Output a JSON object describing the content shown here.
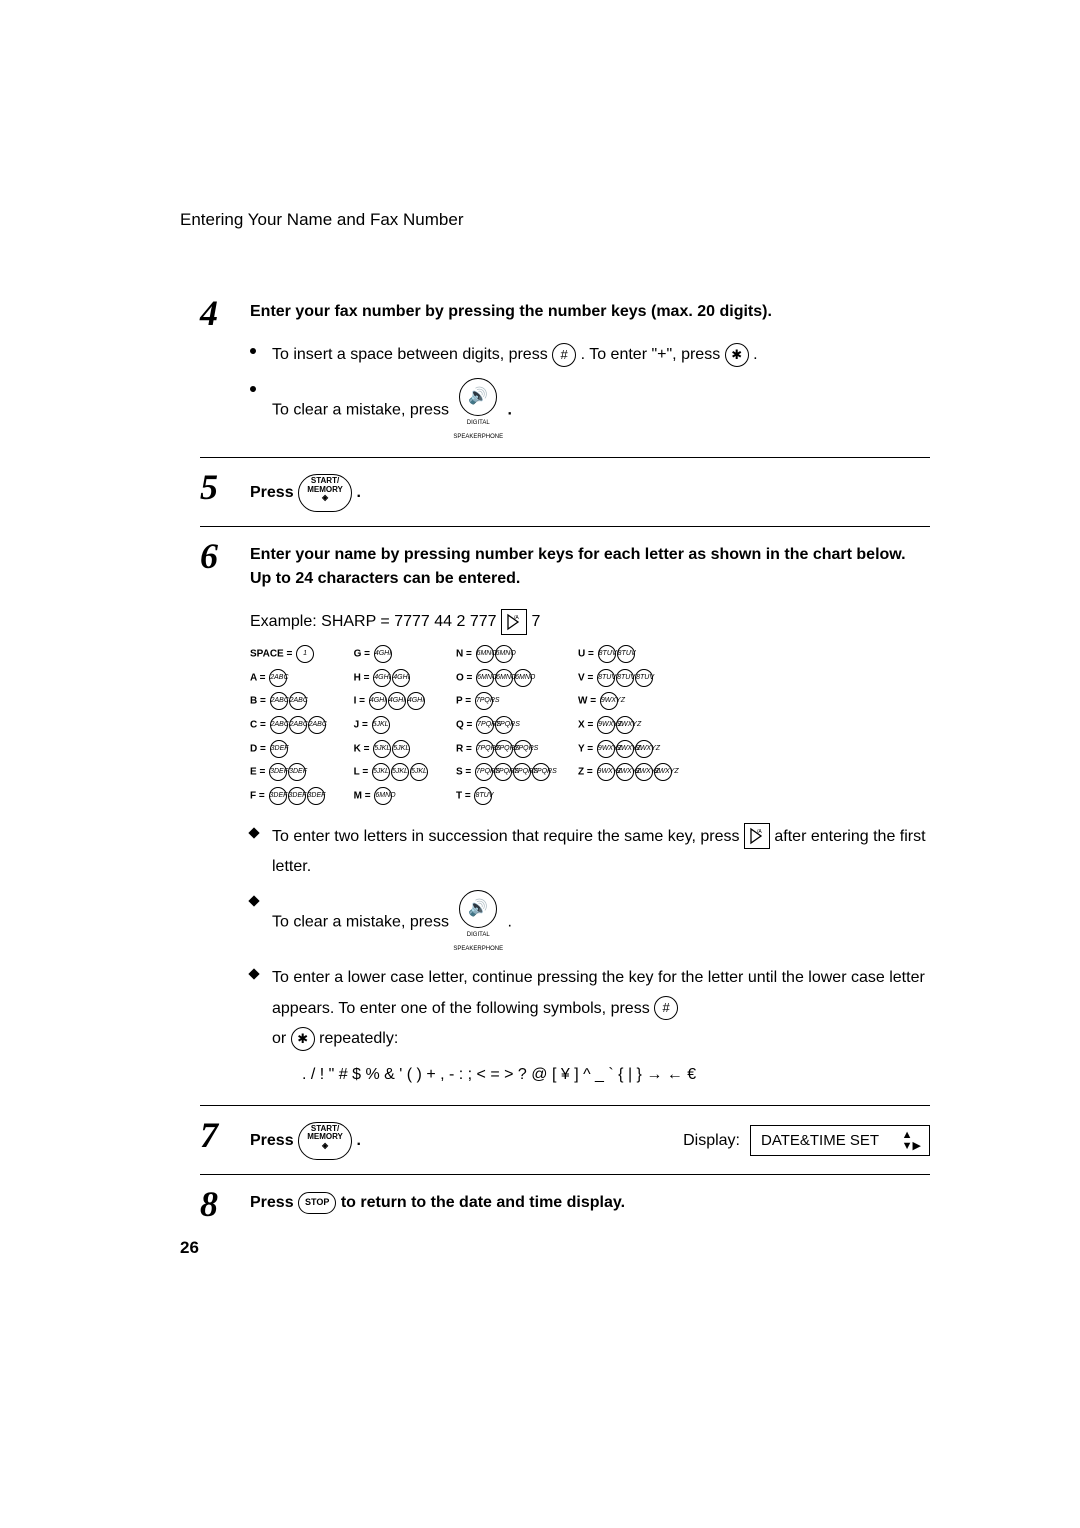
{
  "header": {
    "title": "Entering Your Name and Fax Number"
  },
  "steps": {
    "s4": {
      "num": "4",
      "title": "Enter your fax number by pressing the number keys (max. 20 digits).",
      "b1_pre": "To insert a space between digits, press ",
      "b1_mid": ". To enter \"+\", press ",
      "b1_post": ".",
      "b2": "To clear a mistake, press "
    },
    "s5": {
      "num": "5",
      "title_pre": "Press ",
      "title_post": " ."
    },
    "s6": {
      "num": "6",
      "title": "Enter your name by pressing number keys for each letter as shown in the chart below. Up to 24 characters can be entered.",
      "example_pre": "Example: SHARP = 7777  44  2  777 ",
      "example_post": " 7",
      "d1_pre": "To enter two letters in succession that require the same key, press ",
      "d1_post": " after entering the first letter.",
      "d2": "To clear a mistake, press ",
      "d3_a": "To enter a lower case letter, continue pressing the key for the letter until the lower case letter appears. To enter one of the following symbols, press ",
      "d3_b": "or ",
      "d3_c": " repeatedly:",
      "symbols": ". / ! \" # $ % & ' ( )  + , - : ; < = > ? @ [ ¥ ]  ^ _ ` { | } → ← €"
    },
    "s7": {
      "num": "7",
      "title_pre": "Press ",
      "title_post": " .",
      "display_label": "Display:",
      "display_text": "DATE&TIME SET"
    },
    "s8": {
      "num": "8",
      "title_pre": "Press ",
      "title_post": " to return to the date and time display."
    }
  },
  "keys": {
    "hash": "#",
    "star": "✱",
    "start_memory_l1": "START/",
    "start_memory_l2": "MEMORY",
    "stop": "STOP",
    "speaker_sub1": "DIGITAL",
    "speaker_sub2": "SPEAKERPHONE",
    "right_arrow": "▷/A"
  },
  "char_map": {
    "col1": [
      {
        "label": "SPACE =",
        "keys": [
          "1"
        ]
      },
      {
        "label": "A =",
        "keys": [
          "2ABC"
        ]
      },
      {
        "label": "B =",
        "keys": [
          "2ABC",
          "2ABC"
        ]
      },
      {
        "label": "C =",
        "keys": [
          "2ABC",
          "2ABC",
          "2ABC"
        ]
      },
      {
        "label": "D =",
        "keys": [
          "3DEF"
        ]
      },
      {
        "label": "E =",
        "keys": [
          "3DEF",
          "3DEF"
        ]
      },
      {
        "label": "F =",
        "keys": [
          "3DEF",
          "3DEF",
          "3DEF"
        ]
      }
    ],
    "col2": [
      {
        "label": "G =",
        "keys": [
          "4GHI"
        ]
      },
      {
        "label": "H =",
        "keys": [
          "4GHI",
          "4GHI"
        ]
      },
      {
        "label": "I =",
        "keys": [
          "4GHI",
          "4GHI",
          "4GHI"
        ]
      },
      {
        "label": "J =",
        "keys": [
          "5JKL"
        ]
      },
      {
        "label": "K =",
        "keys": [
          "5JKL",
          "5JKL"
        ]
      },
      {
        "label": "L =",
        "keys": [
          "5JKL",
          "5JKL",
          "5JKL"
        ]
      },
      {
        "label": "M =",
        "keys": [
          "6MNO"
        ]
      }
    ],
    "col3": [
      {
        "label": "N =",
        "keys": [
          "6MNO",
          "6MNO"
        ]
      },
      {
        "label": "O =",
        "keys": [
          "6MNO",
          "6MNO",
          "6MNO"
        ]
      },
      {
        "label": "P =",
        "keys": [
          "7PQRS"
        ]
      },
      {
        "label": "Q =",
        "keys": [
          "7PQRS",
          "7PQRS"
        ]
      },
      {
        "label": "R =",
        "keys": [
          "7PQRS",
          "7PQRS",
          "7PQRS"
        ]
      },
      {
        "label": "S =",
        "keys": [
          "7PQRS",
          "7PQRS",
          "7PQRS",
          "7PQRS"
        ]
      },
      {
        "label": "T =",
        "keys": [
          "8TUV"
        ]
      }
    ],
    "col4": [
      {
        "label": "U =",
        "keys": [
          "8TUV",
          "8TUV"
        ]
      },
      {
        "label": "V =",
        "keys": [
          "8TUV",
          "8TUV",
          "8TUV"
        ]
      },
      {
        "label": "W =",
        "keys": [
          "9WXYZ"
        ]
      },
      {
        "label": "X =",
        "keys": [
          "9WXYZ",
          "9WXYZ"
        ]
      },
      {
        "label": "Y =",
        "keys": [
          "9WXYZ",
          "9WXYZ",
          "9WXYZ"
        ]
      },
      {
        "label": "Z =",
        "keys": [
          "9WXYZ",
          "9WXYZ",
          "9WXYZ",
          "9WXYZ"
        ]
      }
    ]
  },
  "page_number": "26"
}
